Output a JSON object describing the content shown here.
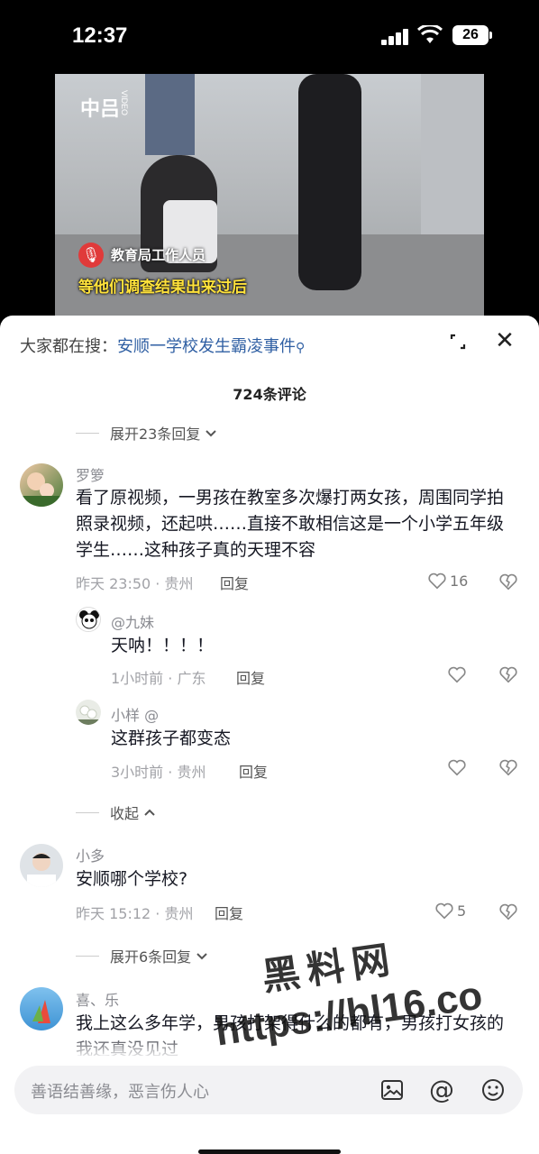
{
  "status_bar": {
    "time": "12:37",
    "battery": "26"
  },
  "video": {
    "logo": "中吕",
    "logo_sub": "VIDEO",
    "speaker": "教育局工作人员",
    "caption": "等他们调查结果出来过后"
  },
  "search": {
    "prefix": "大家都在搜：",
    "query": "安顺一学校发生霸凌事件"
  },
  "comments_count": "724条评论",
  "expand_top": "展开23条回复",
  "comments": [
    {
      "user": "罗箩",
      "text": "看了原视频，一男孩在教室多次爆打两女孩，周围同学拍照录视频，还起哄……直接不敢相信这是一个小学五年级学生……这种孩子真的天理不容",
      "meta": "昨天 23:50 · 贵州",
      "reply": "回复",
      "likes": "16"
    },
    {
      "user": "小多",
      "text": "安顺哪个学校?",
      "meta": "昨天 15:12 · 贵州",
      "reply": "回复",
      "likes": "5"
    },
    {
      "user": "喜、乐",
      "text": "我上这么多年学，男孩打架得什么的都有，男孩打女孩的我还真没见过"
    }
  ],
  "replies": [
    {
      "user": "@九妹",
      "text": "天呐！！！！",
      "meta": "1小时前 · 广东",
      "reply": "回复"
    },
    {
      "user": "小样 @",
      "text": "这群孩子都变态",
      "meta": "3小时前 · 贵州",
      "reply": "回复"
    }
  ],
  "collapse": "收起",
  "expand_second": "展开6条回复",
  "input": {
    "placeholder": "善语结善缘，恶言伤人心"
  },
  "watermark": {
    "line1": "黑料网",
    "line2": "https://hl16.co"
  },
  "colors": {
    "link": "#2f5fa3",
    "caption": "#ffe23b",
    "panel_bg": "#ffffff"
  }
}
